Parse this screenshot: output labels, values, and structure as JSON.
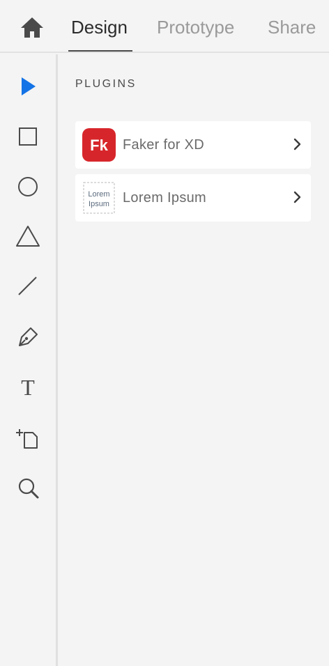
{
  "header": {
    "home_icon": "home-icon",
    "tabs": [
      {
        "label": "Design",
        "active": true
      },
      {
        "label": "Prototype",
        "active": false
      },
      {
        "label": "Share",
        "active": false
      }
    ]
  },
  "toolbar": {
    "tools": [
      {
        "name": "select-tool",
        "icon": "arrow-pointer-icon",
        "active": true
      },
      {
        "name": "rectangle-tool",
        "icon": "rectangle-icon"
      },
      {
        "name": "ellipse-tool",
        "icon": "ellipse-icon"
      },
      {
        "name": "polygon-tool",
        "icon": "triangle-icon"
      },
      {
        "name": "line-tool",
        "icon": "line-icon"
      },
      {
        "name": "pen-tool",
        "icon": "pen-icon"
      },
      {
        "name": "text-tool",
        "icon": "text-icon"
      },
      {
        "name": "artboard-tool",
        "icon": "artboard-icon"
      },
      {
        "name": "zoom-tool",
        "icon": "magnifier-icon"
      }
    ]
  },
  "panel": {
    "title": "PLUGINS",
    "plugins": [
      {
        "name": "Faker for XD",
        "icon_text": "Fk"
      },
      {
        "name": "Lorem Ipsum",
        "icon_text_line1": "Lorem",
        "icon_text_line2": "Ipsum"
      }
    ]
  },
  "colors": {
    "accent": "#1473e6",
    "faker_red": "#d7262b",
    "background": "#f4f4f4"
  }
}
